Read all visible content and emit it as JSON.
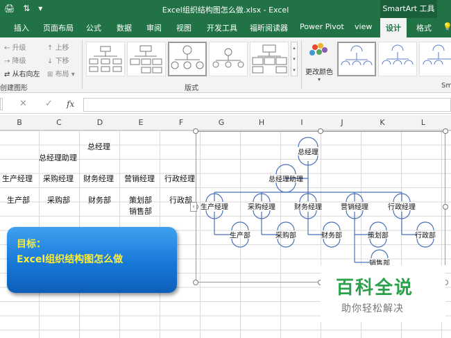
{
  "window": {
    "title": "Excel组织结构图怎么做.xlsx  -  Excel",
    "contextual_tab": "SmartArt 工具"
  },
  "tabs": [
    {
      "label": "插入"
    },
    {
      "label": "页面布局"
    },
    {
      "label": "公式"
    },
    {
      "label": "数据"
    },
    {
      "label": "审阅"
    },
    {
      "label": "视图"
    },
    {
      "label": "开发工具"
    },
    {
      "label": "福昕阅读器"
    },
    {
      "label": "Power Pivot"
    },
    {
      "label": "view"
    },
    {
      "label": "设计",
      "active": true
    },
    {
      "label": "格式"
    }
  ],
  "ribbon": {
    "create_graphic": {
      "promote": "升级",
      "demote": "降级",
      "right_to_left": "从右向左",
      "move_up": "上移",
      "move_down": "下移",
      "layout": "布局",
      "group_label": "创建图形"
    },
    "layouts_group_label": "版式",
    "change_colors": "更改颜色",
    "styles_cut_label": "Sm"
  },
  "formula_bar": {
    "fx": "fx",
    "cancel": "✕",
    "confirm": "✓",
    "value": ""
  },
  "columns": [
    "B",
    "C",
    "D",
    "E",
    "F",
    "G",
    "H",
    "I",
    "J",
    "K",
    "L"
  ],
  "cells": {
    "d_top": "总经理",
    "c_assistant": "总经理助理",
    "b_mgr": "生产经理",
    "c_mgr": "采购经理",
    "d_mgr": "财务经理",
    "e_mgr": "营销经理",
    "f_mgr": "行政经理",
    "b_dept": "生产部",
    "c_dept": "采购部",
    "d_dept": "财务部",
    "e_dept": "策划部",
    "e_dept2": "销售部",
    "f_dept": "行政部"
  },
  "banner": {
    "line1": "目标：",
    "line2": "Excel组织结构图怎么做"
  },
  "org": {
    "top": "总经理",
    "assistant": "总经理助理",
    "managers": [
      "生产经理",
      "采购经理",
      "财务经理",
      "营销经理",
      "行政经理"
    ],
    "departments": [
      "生产部",
      "采购部",
      "财务部",
      "策划部",
      "行政部"
    ],
    "extra_department": "销售部"
  },
  "watermark": {
    "title": "百科全说",
    "subtitle": "助你轻松解决"
  },
  "colors": {
    "excel_green": "#217346",
    "banner_text": "#ffee33",
    "connector": "#4a70b8",
    "watermark_green": "#2aa14a"
  }
}
